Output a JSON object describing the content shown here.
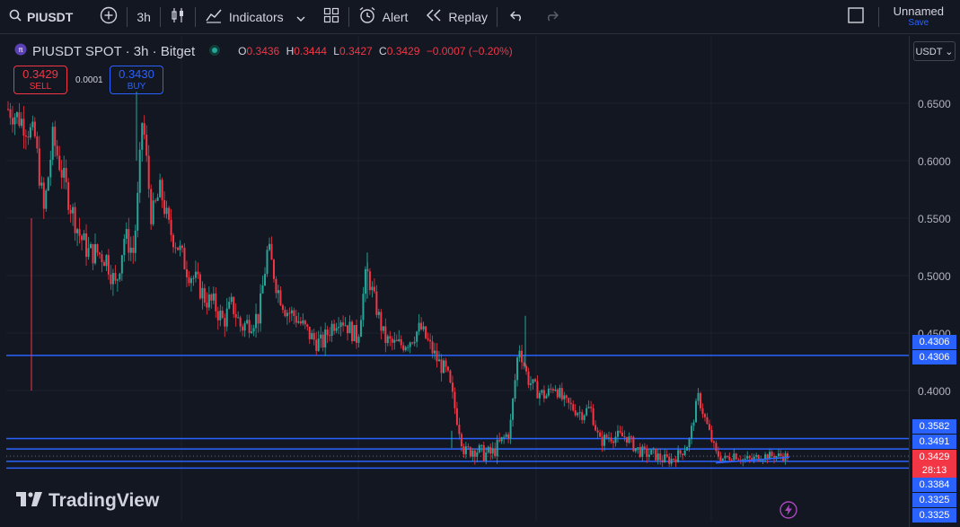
{
  "topbar": {
    "symbol": "PIUSDT",
    "interval": "3h",
    "indicators_label": "Indicators",
    "alert_label": "Alert",
    "replay_label": "Replay",
    "layout_name": "Unnamed",
    "save_label": "Save"
  },
  "legend": {
    "title": "PIUSDT SPOT · 3h · Bitget",
    "o_label": "O",
    "o_value": "0.3436",
    "h_label": "H",
    "h_value": "0.3444",
    "l_label": "L",
    "l_value": "0.3427",
    "c_label": "C",
    "c_value": "0.3429",
    "change": "−0.0007 (−0.20%)"
  },
  "trade": {
    "sell_price": "0.3429",
    "sell_label": "SELL",
    "buy_price": "0.3430",
    "buy_label": "BUY",
    "spread": "0.0001"
  },
  "currency_button": "USDT",
  "yaxis": {
    "labels": [
      "0.6500",
      "0.6000",
      "0.5500",
      "0.5000",
      "0.4500",
      "0.4000"
    ],
    "badges": [
      {
        "value": "0.4306",
        "color": "#2962ff"
      },
      {
        "value": "0.4306",
        "color": "#2962ff"
      },
      {
        "value": "0.3582",
        "color": "#2962ff"
      },
      {
        "value": "0.3491",
        "color": "#2962ff"
      },
      {
        "value": "0.3429",
        "color": "#f23645"
      },
      {
        "value": "28:13",
        "color": "#f23645"
      },
      {
        "value": "0.3384",
        "color": "#2962ff"
      },
      {
        "value": "0.3325",
        "color": "#2962ff"
      },
      {
        "value": "0.3325",
        "color": "#2962ff"
      }
    ]
  },
  "horizontal_lines": [
    0.4306,
    0.3582,
    0.3491,
    0.3384,
    0.3325
  ],
  "watermark": "TradingView",
  "colors": {
    "up": "#26a69a",
    "down": "#f23645",
    "accent": "#2962ff",
    "bg": "#131722"
  },
  "series": {
    "key_points": [
      [
        0,
        0.645
      ],
      [
        3,
        0.635
      ],
      [
        6,
        0.62
      ],
      [
        8,
        0.555
      ],
      [
        10,
        0.62
      ],
      [
        12,
        0.59
      ],
      [
        14,
        0.56
      ],
      [
        16,
        0.535
      ],
      [
        18,
        0.52
      ],
      [
        20,
        0.52
      ],
      [
        22,
        0.515
      ],
      [
        24,
        0.49
      ],
      [
        26,
        0.535
      ],
      [
        28,
        0.52
      ],
      [
        29,
        0.57
      ],
      [
        30,
        0.64
      ],
      [
        32,
        0.55
      ],
      [
        34,
        0.575
      ],
      [
        36,
        0.54
      ],
      [
        38,
        0.525
      ],
      [
        40,
        0.505
      ],
      [
        42,
        0.495
      ],
      [
        44,
        0.48
      ],
      [
        46,
        0.475
      ],
      [
        48,
        0.46
      ],
      [
        50,
        0.475
      ],
      [
        52,
        0.455
      ],
      [
        54,
        0.46
      ],
      [
        56,
        0.465
      ],
      [
        58,
        0.525
      ],
      [
        60,
        0.49
      ],
      [
        62,
        0.47
      ],
      [
        64,
        0.465
      ],
      [
        66,
        0.455
      ],
      [
        68,
        0.445
      ],
      [
        70,
        0.44
      ],
      [
        72,
        0.455
      ],
      [
        74,
        0.465
      ],
      [
        76,
        0.455
      ],
      [
        78,
        0.445
      ],
      [
        80,
        0.505
      ],
      [
        82,
        0.475
      ],
      [
        84,
        0.445
      ],
      [
        86,
        0.44
      ],
      [
        88,
        0.44
      ],
      [
        90,
        0.445
      ],
      [
        92,
        0.455
      ],
      [
        94,
        0.44
      ],
      [
        96,
        0.425
      ],
      [
        98,
        0.415
      ],
      [
        100,
        0.38
      ],
      [
        102,
        0.345
      ],
      [
        104,
        0.35
      ],
      [
        106,
        0.345
      ],
      [
        108,
        0.345
      ],
      [
        110,
        0.355
      ],
      [
        112,
        0.365
      ],
      [
        114,
        0.44
      ],
      [
        116,
        0.41
      ],
      [
        118,
        0.4
      ],
      [
        120,
        0.395
      ],
      [
        122,
        0.405
      ],
      [
        124,
        0.39
      ],
      [
        126,
        0.385
      ],
      [
        128,
        0.38
      ],
      [
        130,
        0.385
      ],
      [
        132,
        0.355
      ],
      [
        134,
        0.36
      ],
      [
        136,
        0.36
      ],
      [
        138,
        0.36
      ],
      [
        140,
        0.35
      ],
      [
        142,
        0.345
      ],
      [
        144,
        0.345
      ],
      [
        146,
        0.34
      ],
      [
        148,
        0.34
      ],
      [
        150,
        0.345
      ],
      [
        152,
        0.355
      ],
      [
        154,
        0.395
      ],
      [
        156,
        0.37
      ],
      [
        158,
        0.345
      ],
      [
        160,
        0.34
      ],
      [
        162,
        0.345
      ],
      [
        164,
        0.34
      ],
      [
        166,
        0.34
      ],
      [
        168,
        0.343
      ],
      [
        170,
        0.343
      ],
      [
        172,
        0.343
      ],
      [
        174,
        0.3429
      ]
    ]
  }
}
